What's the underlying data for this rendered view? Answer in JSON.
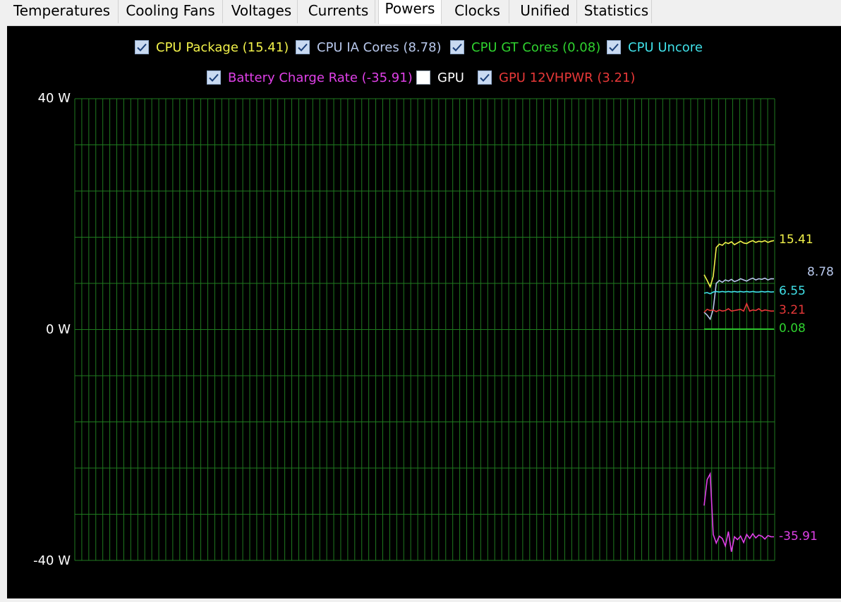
{
  "tabs": [
    {
      "label": "Temperatures",
      "active": false
    },
    {
      "label": "Cooling Fans",
      "active": false
    },
    {
      "label": "Voltages",
      "active": false
    },
    {
      "label": "Currents",
      "active": false
    },
    {
      "label": "Powers",
      "active": true
    },
    {
      "label": "Clocks",
      "active": false
    },
    {
      "label": "Unified",
      "active": false
    },
    {
      "label": "Statistics",
      "active": false
    }
  ],
  "legend": [
    {
      "label": "CPU Package (15.41)",
      "checked": true,
      "color": "#f2f24a"
    },
    {
      "label": "CPU IA Cores (8.78)",
      "checked": true,
      "color": "#b8c8ec"
    },
    {
      "label": "CPU GT Cores (0.08)",
      "checked": true,
      "color": "#2fd22f"
    },
    {
      "label": "CPU Uncore",
      "checked": true,
      "color": "#40e0e8"
    },
    {
      "label": "Battery Charge Rate (-35.91)",
      "checked": true,
      "color": "#e040e8"
    },
    {
      "label": "GPU",
      "checked": false,
      "color": "#ffffff"
    },
    {
      "label": "GPU 12VHPWR (3.21)",
      "checked": true,
      "color": "#e83838"
    }
  ],
  "chart_data": {
    "type": "line",
    "ylim": [
      -40,
      40
    ],
    "yticks": [
      "40 W",
      "0 W",
      "-40 W"
    ],
    "grid": true,
    "grid_color": "#1f7a1f",
    "series": [
      {
        "name": "CPU Package",
        "current_label": "15.41",
        "color": "#f2f24a",
        "values": [
          9.5,
          8.5,
          7.4,
          9.2,
          14.2,
          14.8,
          14.6,
          15.1,
          14.9,
          15.2,
          14.7,
          15.0,
          15.3,
          15.0,
          14.9,
          15.2,
          15.4,
          15.1,
          15.3,
          15.2,
          15.4,
          15.1,
          15.3,
          15.41
        ]
      },
      {
        "name": "CPU IA Cores",
        "current_label": "8.78",
        "color": "#b8c8ec",
        "values": [
          3.0,
          2.5,
          1.8,
          3.5,
          8.0,
          8.5,
          8.2,
          8.6,
          8.4,
          8.7,
          8.3,
          8.5,
          8.8,
          8.6,
          8.4,
          8.7,
          8.9,
          8.6,
          8.8,
          8.7,
          8.9,
          8.6,
          8.8,
          8.78
        ]
      },
      {
        "name": "CPU Uncore",
        "current_label": "6.55",
        "color": "#40e0e8",
        "values": [
          6.3,
          6.4,
          6.2,
          6.5,
          6.6,
          6.5,
          6.6,
          6.5,
          6.6,
          6.5,
          6.6,
          6.5,
          6.6,
          6.5,
          6.6,
          6.5,
          6.6,
          6.5,
          6.5,
          6.6,
          6.5,
          6.6,
          6.5,
          6.55
        ]
      },
      {
        "name": "GPU 12VHPWR",
        "current_label": "3.21",
        "color": "#e83838",
        "values": [
          3.0,
          3.5,
          3.3,
          3.4,
          3.1,
          3.4,
          3.2,
          3.3,
          3.6,
          3.2,
          3.3,
          3.4,
          3.5,
          3.2,
          4.5,
          3.2,
          3.4,
          3.3,
          3.6,
          3.2,
          3.4,
          3.3,
          3.2,
          3.21
        ]
      },
      {
        "name": "CPU GT Cores",
        "current_label": "0.08",
        "color": "#2fd22f",
        "values": [
          0.08,
          0.08,
          0.08,
          0.08,
          0.08,
          0.08,
          0.08,
          0.08,
          0.08,
          0.08,
          0.08,
          0.08,
          0.08,
          0.08,
          0.08,
          0.08,
          0.08,
          0.08,
          0.08,
          0.08,
          0.08,
          0.08,
          0.08,
          0.08
        ]
      },
      {
        "name": "Battery Charge Rate",
        "current_label": "-35.91",
        "color": "#e040e8",
        "values": [
          -30.5,
          -26.0,
          -25.0,
          -35.5,
          -37.0,
          -35.8,
          -36.2,
          -37.5,
          -35.0,
          -38.5,
          -35.9,
          -36.4,
          -35.8,
          -36.9,
          -35.5,
          -36.2,
          -35.4,
          -36.1,
          -35.6,
          -35.8,
          -36.3,
          -35.7,
          -35.9,
          -35.91
        ]
      }
    ]
  }
}
